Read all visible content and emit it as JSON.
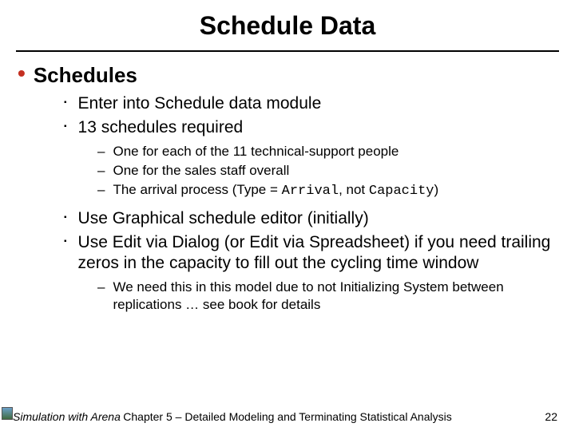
{
  "title": "Schedule Data",
  "lvl1": {
    "text": "Schedules"
  },
  "group1": {
    "a": "Enter into Schedule data module",
    "b": "13 schedules required"
  },
  "sub1": {
    "a": "One for each of the 11 technical-support people",
    "b": "One for the sales staff overall",
    "c_pre": "The arrival process (Type = ",
    "c_code1": "Arrival",
    "c_mid": ", not ",
    "c_code2": "Capacity",
    "c_post": ")"
  },
  "group2": {
    "a": "Use Graphical schedule editor (initially)",
    "b": "Use Edit via Dialog (or Edit via Spreadsheet) if you need trailing zeros in the capacity to fill out the cycling time window"
  },
  "sub2": {
    "a": "We need this in this model due to not Initializing System between replications … see book for details"
  },
  "footer": {
    "left": "Simulation with Arena",
    "center": "Chapter 5 – Detailed Modeling and Terminating Statistical Analysis",
    "right": "22"
  }
}
